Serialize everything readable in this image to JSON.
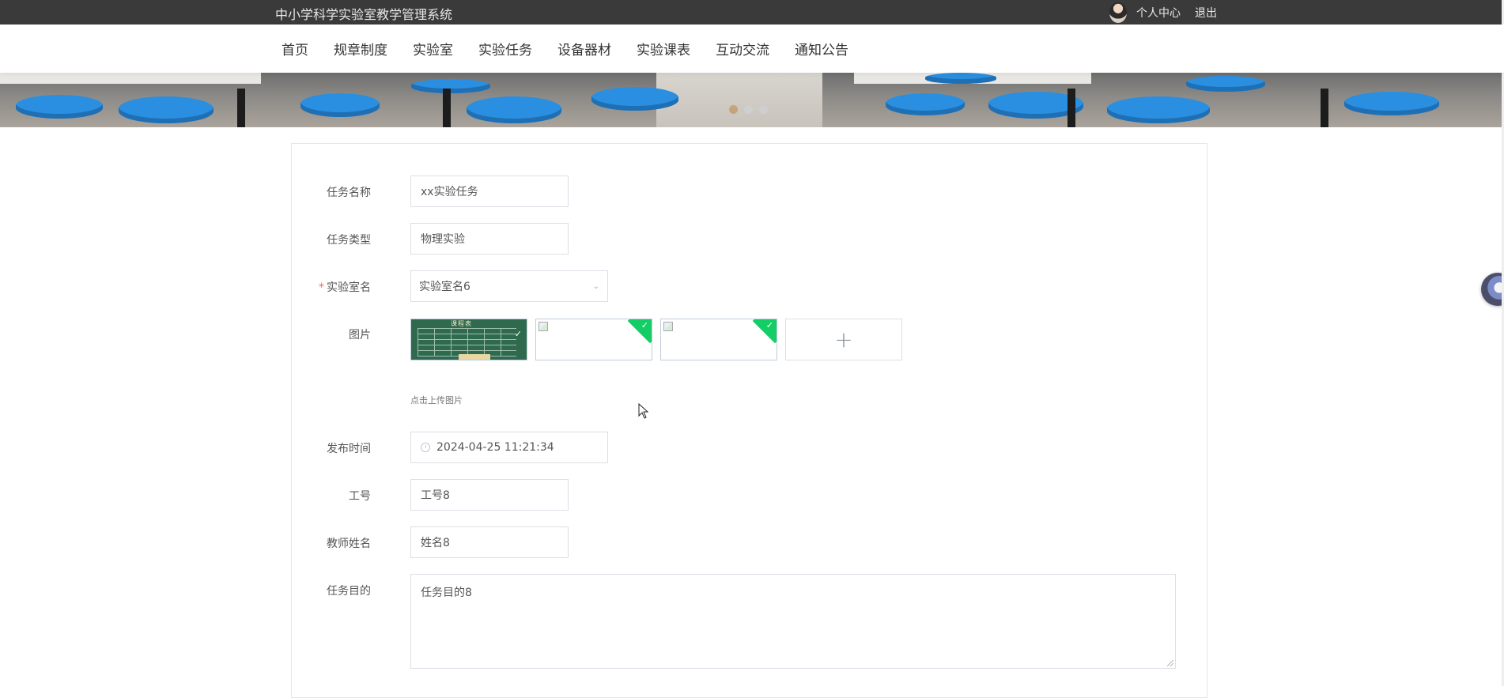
{
  "header": {
    "site_title": "中小学科学实验室教学管理系统",
    "profile_label": "个人中心",
    "logout_label": "退出"
  },
  "nav": {
    "items": [
      "首页",
      "规章制度",
      "实验室",
      "实验任务",
      "设备器材",
      "实验课表",
      "互动交流",
      "通知公告"
    ]
  },
  "banner": {
    "slide_count": 3,
    "active_slide": 1
  },
  "form": {
    "task_name": {
      "label": "任务名称",
      "value": "xx实验任务"
    },
    "task_type": {
      "label": "任务类型",
      "value": "物理实验"
    },
    "lab_name": {
      "label": "实验室名",
      "required_mark": "*",
      "value": "实验室名6"
    },
    "images": {
      "label": "图片",
      "upload_hint": "点击上传图片",
      "add_icon": "+"
    },
    "publish_time": {
      "label": "发布时间",
      "value": "2024-04-25 11:21:34"
    },
    "job_no": {
      "label": "工号",
      "value": "工号8"
    },
    "teacher_name": {
      "label": "教师姓名",
      "value": "姓名8"
    },
    "task_purpose": {
      "label": "任务目的",
      "value": "任务目的8"
    }
  },
  "colors": {
    "topbar": "#3a3a3a",
    "success_corner": "#13ce66",
    "required": "#f56c6c",
    "active_dot": "#c4a57a"
  }
}
